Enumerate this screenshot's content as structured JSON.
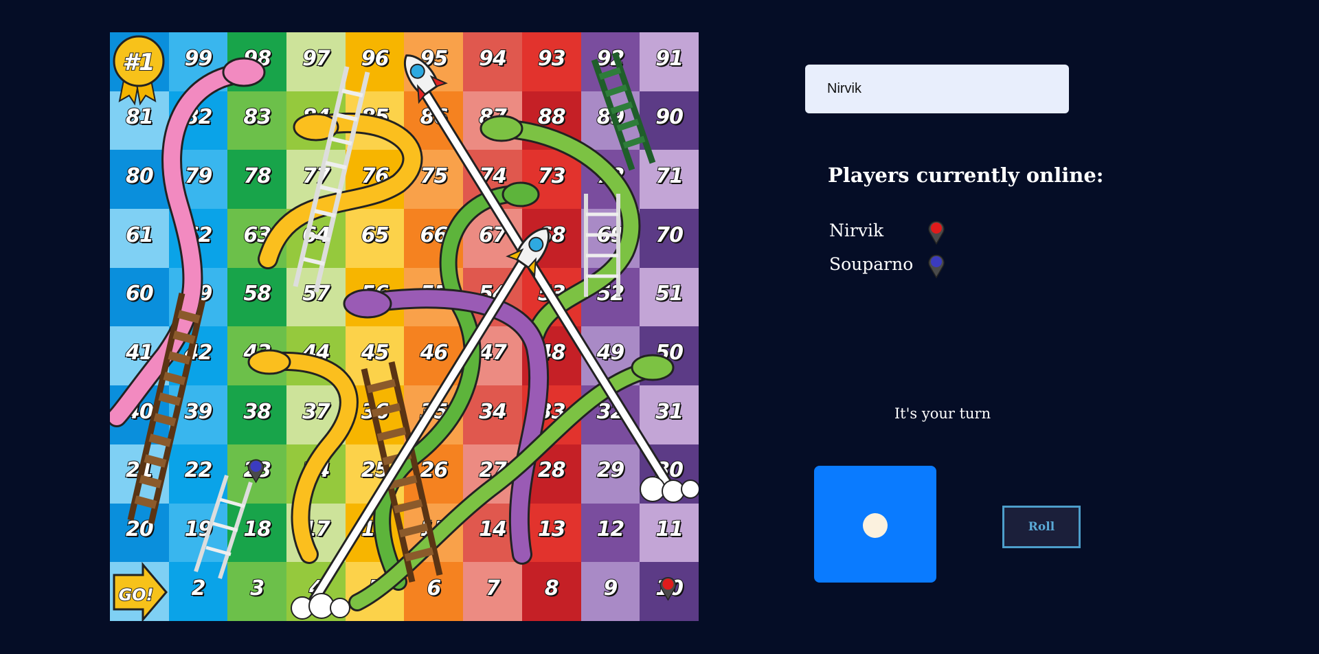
{
  "board": {
    "rows": [
      [
        99,
        98,
        97,
        96,
        95,
        94,
        93,
        92,
        91
      ],
      [
        81,
        82,
        83,
        84,
        85,
        86,
        87,
        88,
        89,
        90
      ],
      [
        80,
        79,
        78,
        77,
        76,
        75,
        74,
        73,
        72,
        71
      ],
      [
        61,
        62,
        63,
        64,
        65,
        66,
        67,
        68,
        69,
        70
      ],
      [
        60,
        59,
        58,
        57,
        56,
        55,
        54,
        53,
        52,
        51
      ],
      [
        41,
        42,
        43,
        44,
        45,
        46,
        47,
        48,
        49,
        50
      ],
      [
        40,
        39,
        38,
        37,
        36,
        35,
        34,
        33,
        32,
        31
      ],
      [
        21,
        22,
        23,
        24,
        25,
        26,
        27,
        28,
        29,
        30
      ],
      [
        20,
        19,
        18,
        17,
        16,
        15,
        14,
        13,
        12,
        11
      ],
      [
        2,
        3,
        4,
        5,
        6,
        7,
        8,
        9,
        10
      ]
    ],
    "badge_text": "#1",
    "start_text": "GO!",
    "column_colors": [
      "#0a8fdc",
      "#0aa3e8",
      "#18a44a",
      "#95c93d",
      "#f7b500",
      "#f58220",
      "#e0584e",
      "#c52026",
      "#7a4d9e",
      "#5c3b86"
    ],
    "light_column_colors": [
      "#7fd0f4",
      "#39b6ee",
      "#6cc04a",
      "#cde39a",
      "#fcd24a",
      "#f9a14a",
      "#ec8b82",
      "#e2332d",
      "#a98ac6",
      "#c3a5d6"
    ]
  },
  "tokens": [
    {
      "player": "Souparno",
      "color": "#3b3bbf",
      "square": 23
    },
    {
      "player": "Nirvik",
      "color": "#e01b1b",
      "square": 10
    }
  ],
  "name_input": {
    "value": "Nirvik"
  },
  "online": {
    "heading": "Players currently online:",
    "players": [
      {
        "name": "Nirvik",
        "color": "#e01b1b"
      },
      {
        "name": "Souparno",
        "color": "#3b3bbf"
      }
    ]
  },
  "turn_text": "It's your turn",
  "dice": {
    "value": 1,
    "color": "#0a7bff"
  },
  "roll_button": {
    "label": "Roll"
  }
}
